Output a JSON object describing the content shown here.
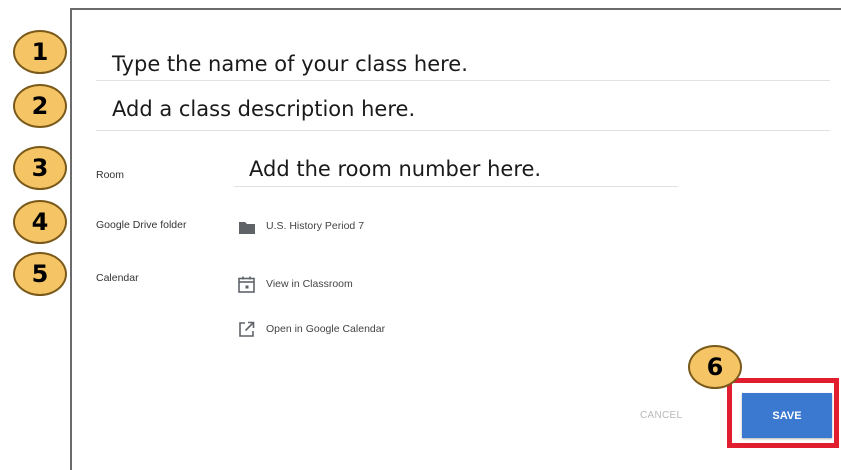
{
  "form": {
    "name_hint": "Type the name of your class here.",
    "description_hint": "Add a class description here.",
    "room": {
      "label": "Room",
      "hint": "Add the room number here."
    },
    "drive": {
      "label": "Google Drive folder",
      "folder_name": "U.S. History Period 7",
      "icon": "folder-icon"
    },
    "calendar": {
      "label": "Calendar",
      "view_link": "View in Classroom",
      "view_icon": "calendar-icon",
      "open_link": "Open in Google Calendar",
      "open_icon": "open-external-icon"
    }
  },
  "actions": {
    "cancel_label": "CANCEL",
    "save_label": "SAVE"
  },
  "badges": [
    "1",
    "2",
    "3",
    "4",
    "5",
    "6"
  ],
  "colors": {
    "badge_fill": "#f5c465",
    "badge_border": "#7a5a1a",
    "save_button": "#3b78d0",
    "highlight_box": "#e01e2e"
  }
}
